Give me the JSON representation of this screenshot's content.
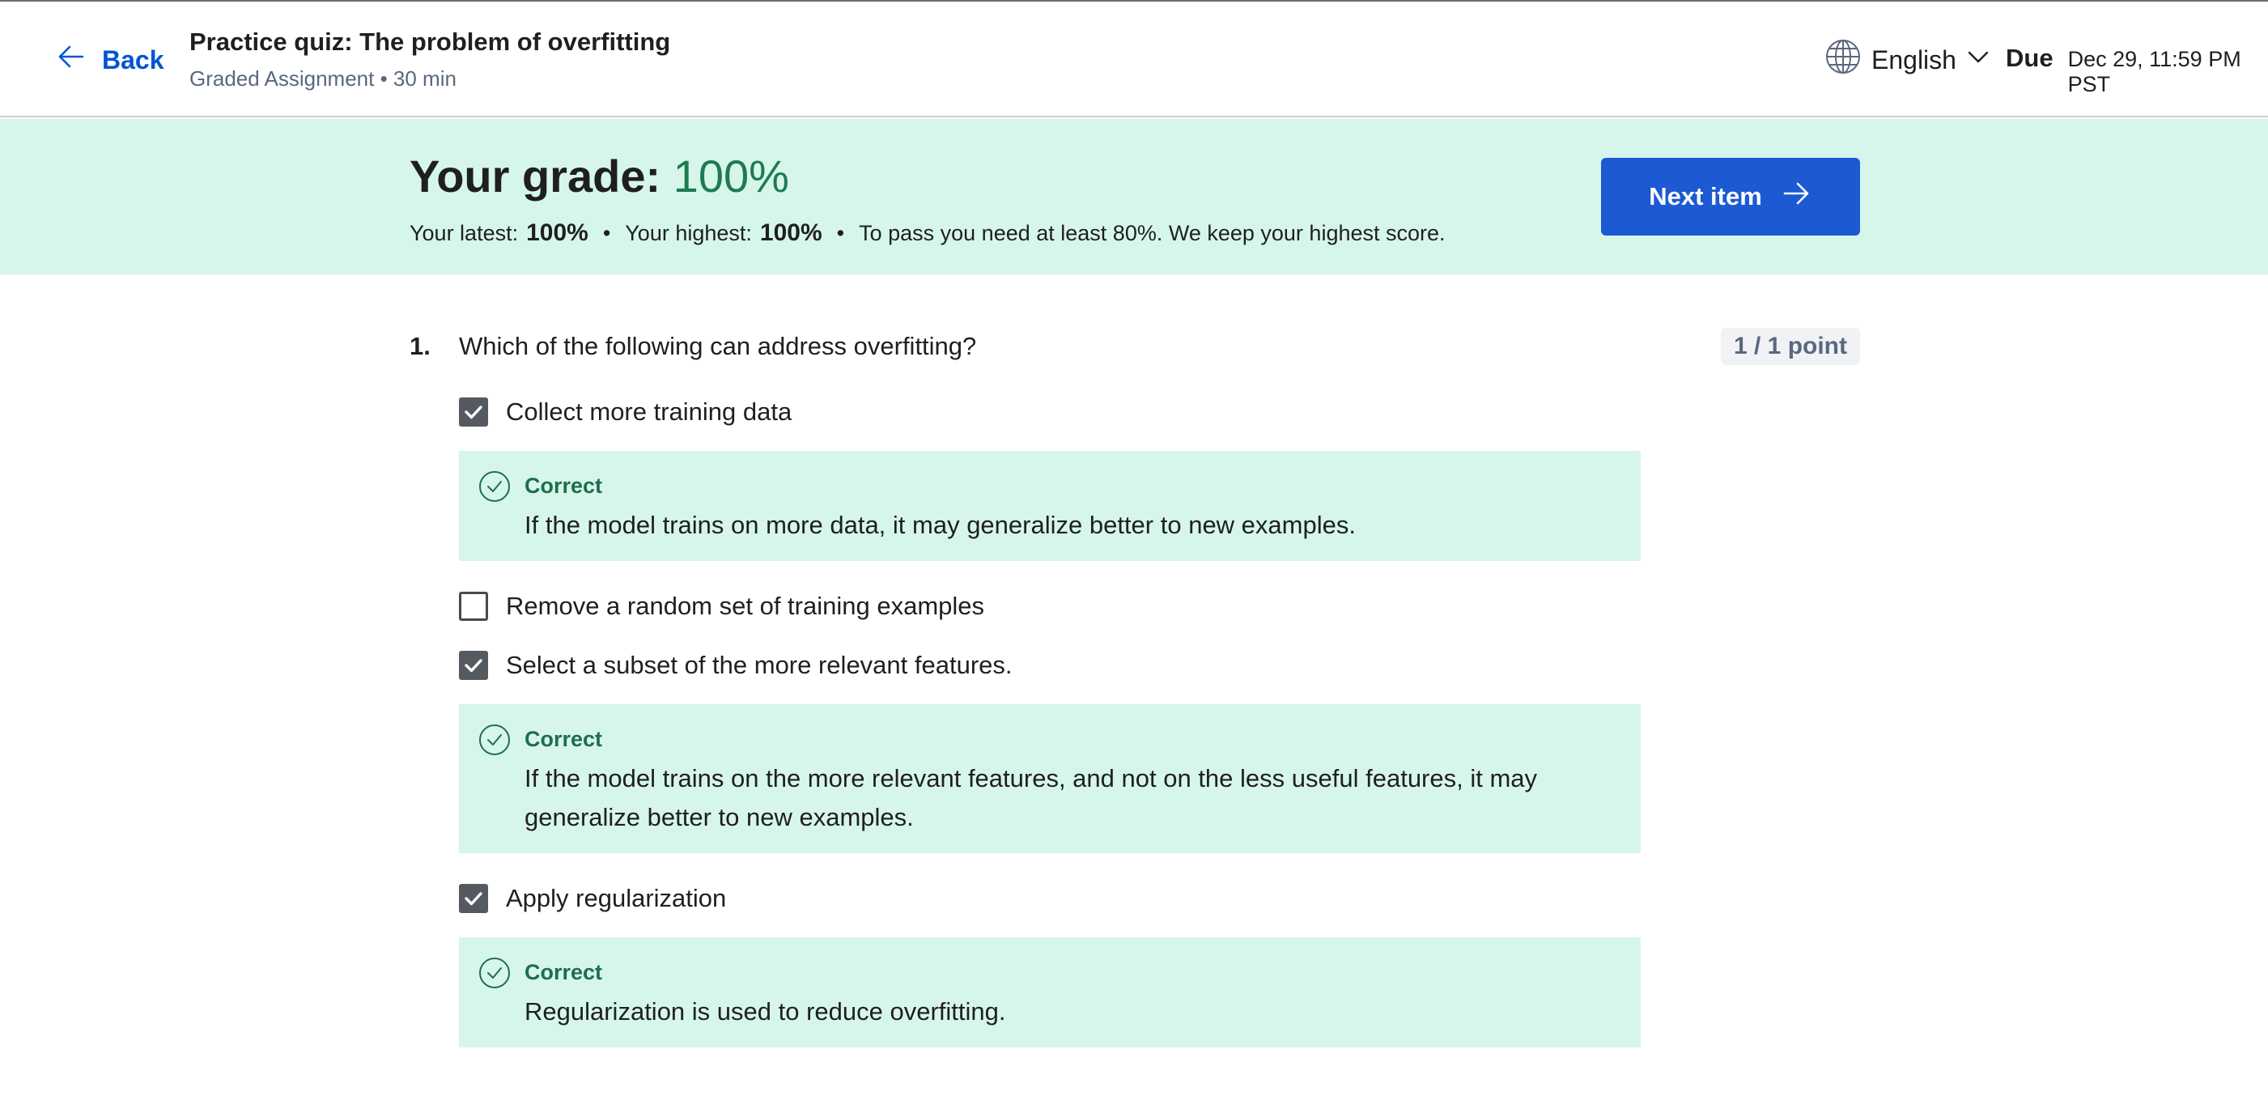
{
  "header": {
    "back_label": "Back",
    "quiz_title": "Practice quiz: The problem of overfitting",
    "quiz_subtitle": "Graded Assignment • 30 min",
    "language": "English",
    "due_label": "Due",
    "due_date": "Dec 29, 11:59 PM PST"
  },
  "grade": {
    "label": "Your grade:",
    "percent": "100%",
    "latest_label": "Your latest:",
    "latest_value": "100%",
    "highest_label": "Your highest:",
    "highest_value": "100%",
    "separator": "•",
    "pass_note": "To pass you need at least 80%. We keep your highest score.",
    "next_label": "Next item"
  },
  "question": {
    "number": "1.",
    "text": "Which of the following can address overfitting?",
    "points": "1 / 1 point",
    "options": [
      {
        "label": "Collect more training data",
        "checked": true,
        "feedback_label": "Correct",
        "feedback_text": "If the model trains on more data, it may generalize better to new examples."
      },
      {
        "label": "Remove a random set of training examples",
        "checked": false
      },
      {
        "label": "Select a subset of the more relevant features.",
        "checked": true,
        "feedback_label": "Correct",
        "feedback_text": "If the model trains on the more relevant features, and not on the less useful features, it may generalize better to new examples."
      },
      {
        "label": "Apply regularization",
        "checked": true,
        "feedback_label": "Correct",
        "feedback_text": "Regularization is used to reduce overfitting."
      }
    ]
  },
  "colors": {
    "accent": "#0056d2",
    "button": "#1c59d3",
    "success_bg": "#d6f6ec",
    "success_text": "#1f7a52"
  },
  "icons": {
    "back": "arrow-left-icon",
    "language": "globe-icon",
    "dropdown": "chevron-down-icon",
    "next": "arrow-right-icon",
    "checkbox": "checkmark-icon",
    "correct": "check-circle-icon"
  }
}
